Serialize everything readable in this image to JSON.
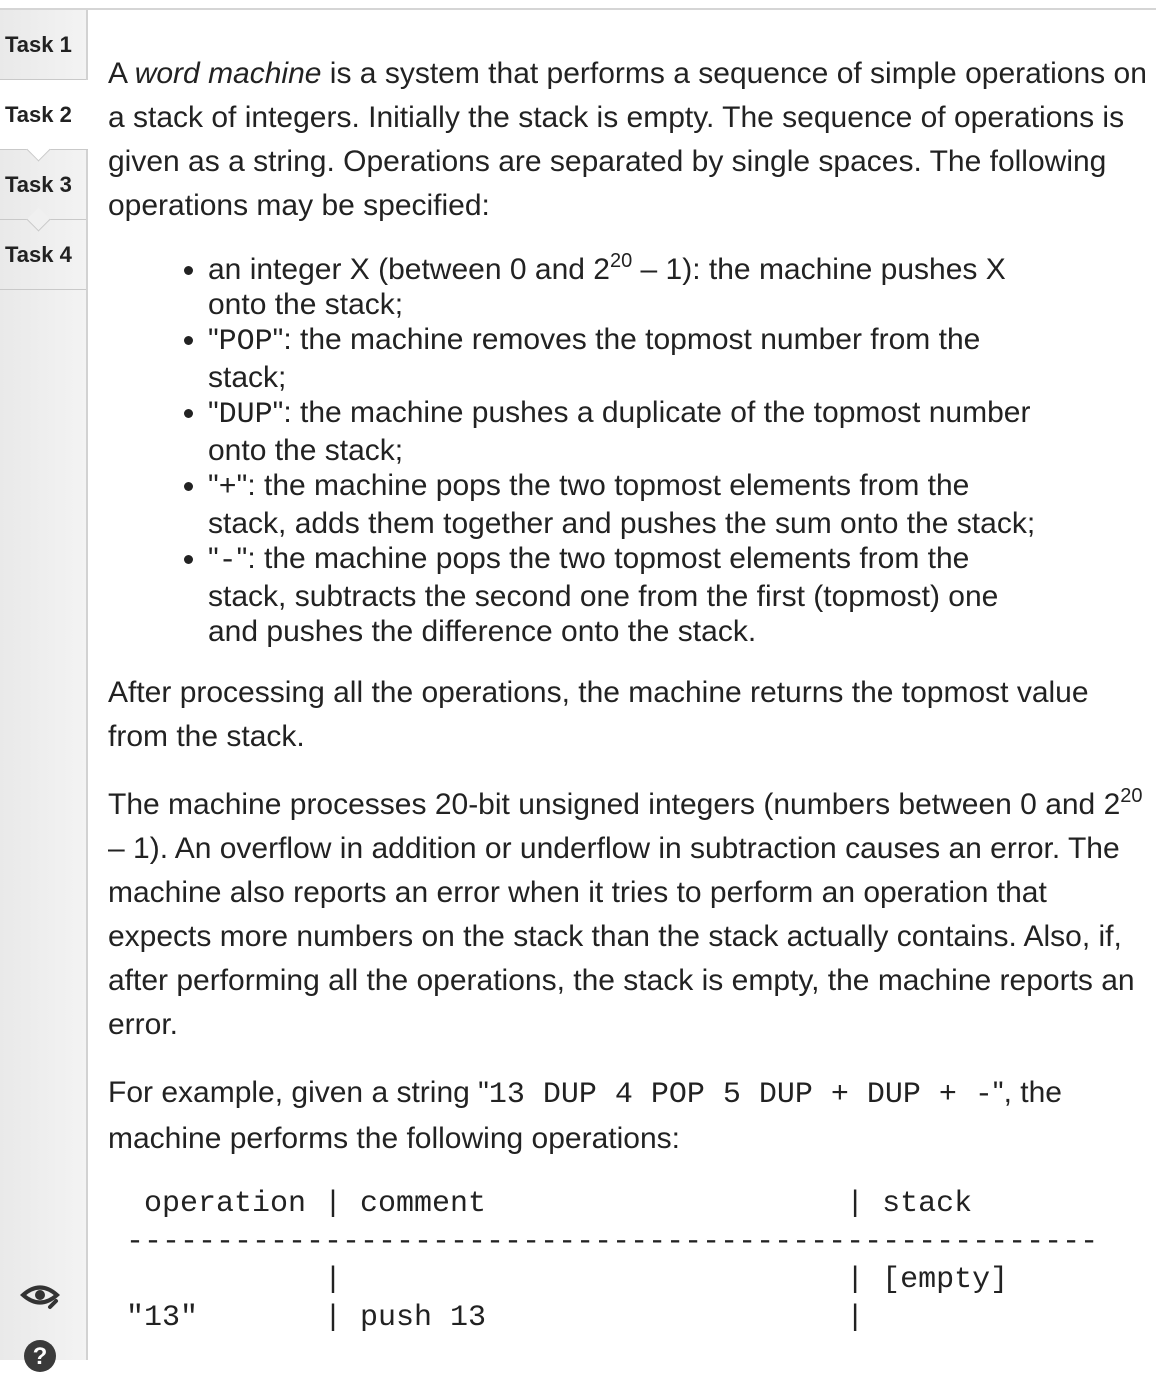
{
  "tabs": [
    {
      "label": "Task 1"
    },
    {
      "label": "Task 2"
    },
    {
      "label": "Task 3"
    },
    {
      "label": "Task 4"
    }
  ],
  "active_tab": 1,
  "intro": {
    "a": "A ",
    "em": "word machine",
    "rest": " is a system that performs a sequence of simple operations on a stack of integers. Initially the stack is empty. The sequence of operations is given as a string. Operations are separated by single spaces. The following operations may be specified:"
  },
  "ops": {
    "int_a": "an integer X (between 0 and 2",
    "int_sup": "20",
    "int_b": " – 1): the machine pushes X onto the stack;",
    "pop_q1": "\"",
    "pop_code": "POP",
    "pop_rest": "\": the machine removes the topmost number from the stack;",
    "dup_q1": "\"",
    "dup_code": "DUP",
    "dup_rest": "\": the machine pushes a duplicate of the topmost number onto the stack;",
    "plus_q1": "\"",
    "plus_code": "+",
    "plus_rest": "\": the machine pops the two topmost elements from the stack, adds them together and pushes the sum onto the stack;",
    "minus_q1": "\"",
    "minus_code": "-",
    "minus_rest": "\": the machine pops the two topmost elements from the stack, subtracts the second one from the first (topmost) one and pushes the difference onto the stack."
  },
  "after": "After processing all the operations, the machine returns the topmost value from the stack.",
  "limits": {
    "a": "The machine processes 20-bit unsigned integers (numbers between 0 and 2",
    "sup": "20",
    "b": " – 1). An overflow in addition or underflow in subtraction causes an error. The machine also reports an error when it tries to perform an operation that expects more numbers on the stack than the stack actually contains. Also, if, after performing all the operations, the stack is empty, the machine reports an error."
  },
  "example": {
    "a": "For example, given a string \"",
    "code": "13 DUP 4 POP 5 DUP + DUP + -",
    "b": "\", the machine performs the following operations:"
  },
  "table_text": " operation | comment                    | stack\n------------------------------------------------------\n           |                            | [empty]\n\"13\"       | push 13                    |"
}
